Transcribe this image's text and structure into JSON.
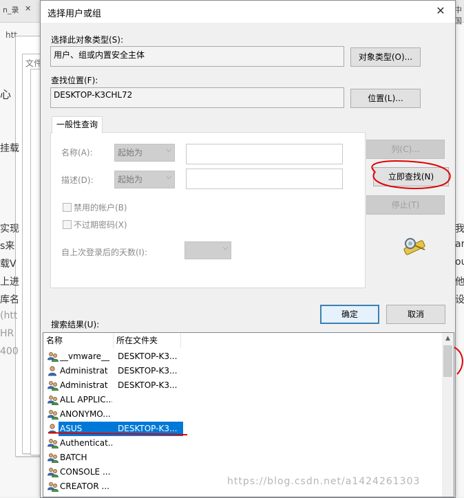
{
  "background": {
    "tab_left": "n_录",
    "tab_left_close": "✕",
    "tab_right": "中国",
    "address_fragment": "htt",
    "side_texts": [
      "心",
      "挂载",
      "实现",
      "s来",
      "载V",
      "上进",
      "库名",
      "(htt",
      "HR",
      "400"
    ],
    "right_texts": [
      "我",
      "ar",
      "ou",
      "他为",
      "设置"
    ],
    "inner_window_text": "文件"
  },
  "dialog": {
    "title": "选择用户或组",
    "close_glyph": "✕",
    "object_type_label": "选择此对象类型(S):",
    "object_type_value": "用户、组或内置安全主体",
    "object_type_button": "对象类型(O)...",
    "location_label": "查找位置(F):",
    "location_value": "DESKTOP-K3CHL72",
    "location_button": "位置(L)...",
    "tab_general": "一般性查询",
    "name_label": "名称(A):",
    "name_combo": "起始为",
    "desc_label": "描述(D):",
    "desc_combo": "起始为",
    "disabled_accounts": "禁用的帐户(B)",
    "non_expiring_pw": "不过期密码(X)",
    "days_since_login": "自上次登录后的天数(I):",
    "columns_button": "列(C)...",
    "find_now_button": "立即查找(N)",
    "stop_button": "停止(T)",
    "search_icon": "binoculars-icon",
    "ok_button": "确定",
    "cancel_button": "取消",
    "results_label": "搜索结果(U):"
  },
  "results": {
    "columns": [
      "名称",
      "所在文件夹"
    ],
    "rows": [
      {
        "name": "__vmware__",
        "folder": "DESKTOP-K3...",
        "icon": "group-icon"
      },
      {
        "name": "Administrat",
        "folder": "DESKTOP-K3...",
        "icon": "user-icon"
      },
      {
        "name": "Administrat",
        "folder": "DESKTOP-K3...",
        "icon": "group-icon"
      },
      {
        "name": "ALL APPLIC...",
        "folder": "",
        "icon": "group-icon"
      },
      {
        "name": "ANONYMO...",
        "folder": "",
        "icon": "group-icon"
      },
      {
        "name": "ASUS",
        "folder": "DESKTOP-K3...",
        "icon": "user-icon"
      },
      {
        "name": "Authenticat...",
        "folder": "",
        "icon": "group-icon"
      },
      {
        "name": "BATCH",
        "folder": "",
        "icon": "group-icon"
      },
      {
        "name": "CONSOLE ...",
        "folder": "",
        "icon": "group-icon"
      },
      {
        "name": "CREATOR ...",
        "folder": "",
        "icon": "group-icon"
      }
    ],
    "selected_index": 5
  },
  "watermark": "https://blog.csdn.net/a1424261303",
  "colors": {
    "selection": "#0078d7",
    "annotation": "#e00000"
  }
}
